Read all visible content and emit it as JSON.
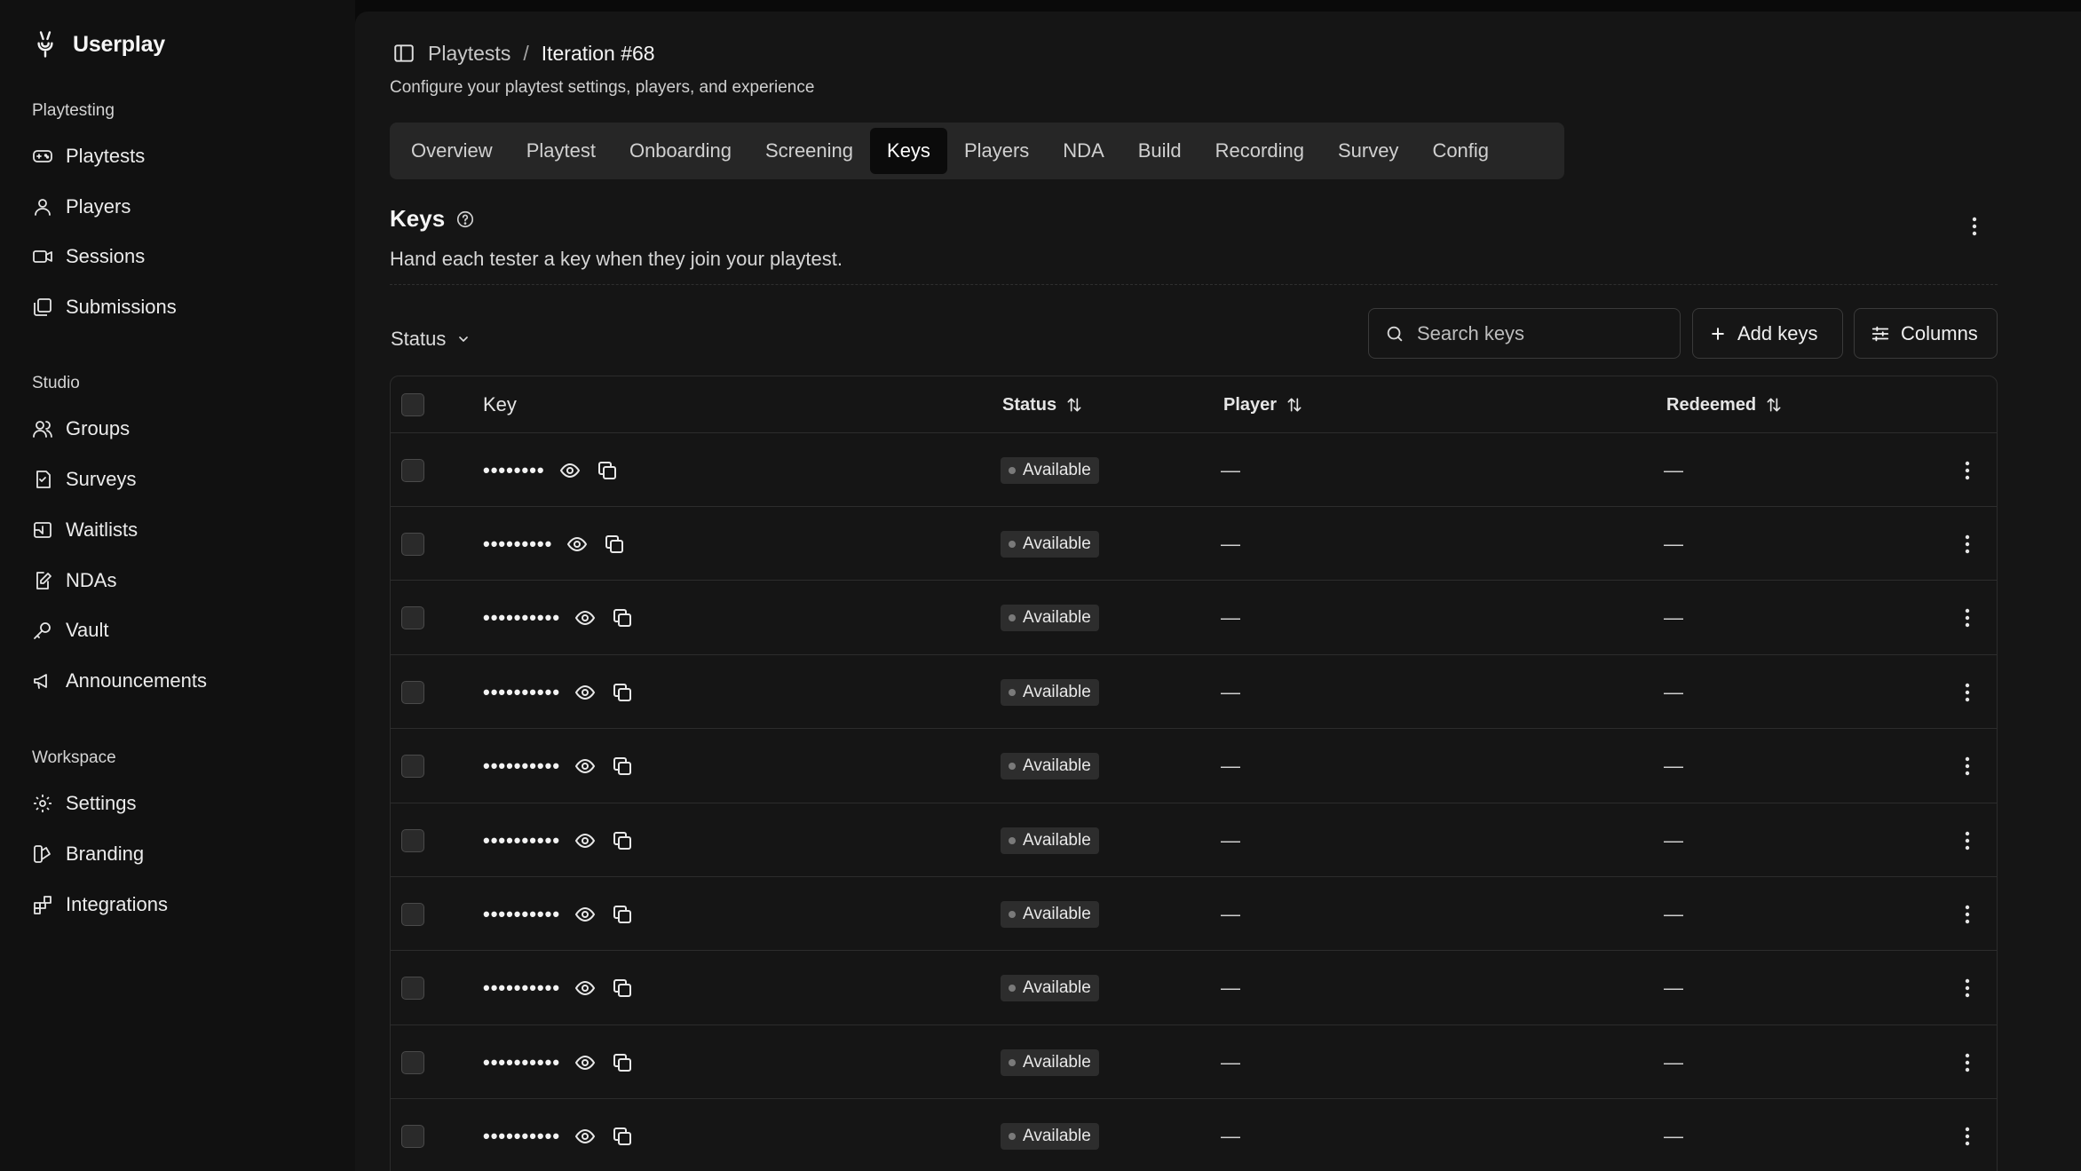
{
  "app": {
    "name": "Userplay"
  },
  "sidebar": {
    "groups": [
      {
        "title": "Playtesting",
        "items": [
          {
            "label": "Playtests",
            "icon": "gamepad-icon"
          },
          {
            "label": "Players",
            "icon": "user-icon"
          },
          {
            "label": "Sessions",
            "icon": "video-icon"
          },
          {
            "label": "Submissions",
            "icon": "stack-icon"
          }
        ]
      },
      {
        "title": "Studio",
        "items": [
          {
            "label": "Groups",
            "icon": "users-icon"
          },
          {
            "label": "Surveys",
            "icon": "survey-icon"
          },
          {
            "label": "Waitlists",
            "icon": "inbox-icon"
          },
          {
            "label": "NDAs",
            "icon": "file-pen-icon"
          },
          {
            "label": "Vault",
            "icon": "key-icon"
          },
          {
            "label": "Announcements",
            "icon": "megaphone-icon"
          }
        ]
      },
      {
        "title": "Workspace",
        "items": [
          {
            "label": "Settings",
            "icon": "gear-icon"
          },
          {
            "label": "Branding",
            "icon": "palette-icon"
          },
          {
            "label": "Integrations",
            "icon": "blocks-icon"
          }
        ]
      }
    ]
  },
  "breadcrumb": {
    "parent": "Playtests",
    "separator": "/",
    "current": "Iteration #68"
  },
  "subtitle": "Configure your playtest settings, players, and experience",
  "tabs": [
    "Overview",
    "Playtest",
    "Onboarding",
    "Screening",
    "Keys",
    "Players",
    "NDA",
    "Build",
    "Recording",
    "Survey",
    "Config"
  ],
  "active_tab": "Keys",
  "section": {
    "title": "Keys",
    "description": "Hand each tester a key when they join your playtest."
  },
  "toolbar": {
    "status_filter": "Status",
    "search_placeholder": "Search keys",
    "add_keys": "Add keys",
    "columns": "Columns"
  },
  "table": {
    "columns": {
      "key": "Key",
      "status": "Status",
      "player": "Player",
      "redeemed": "Redeemed"
    },
    "rows": [
      {
        "key": "••••••••",
        "status": "Available",
        "player": "—",
        "redeemed": "—"
      },
      {
        "key": "•••••••••",
        "status": "Available",
        "player": "—",
        "redeemed": "—"
      },
      {
        "key": "••••••••••",
        "status": "Available",
        "player": "—",
        "redeemed": "—"
      },
      {
        "key": "••••••••••",
        "status": "Available",
        "player": "—",
        "redeemed": "—"
      },
      {
        "key": "••••••••••",
        "status": "Available",
        "player": "—",
        "redeemed": "—"
      },
      {
        "key": "••••••••••",
        "status": "Available",
        "player": "—",
        "redeemed": "—"
      },
      {
        "key": "••••••••••",
        "status": "Available",
        "player": "—",
        "redeemed": "—"
      },
      {
        "key": "••••••••••",
        "status": "Available",
        "player": "—",
        "redeemed": "—"
      },
      {
        "key": "••••••••••",
        "status": "Available",
        "player": "—",
        "redeemed": "—"
      },
      {
        "key": "••••••••••",
        "status": "Available",
        "player": "—",
        "redeemed": "—"
      }
    ]
  }
}
